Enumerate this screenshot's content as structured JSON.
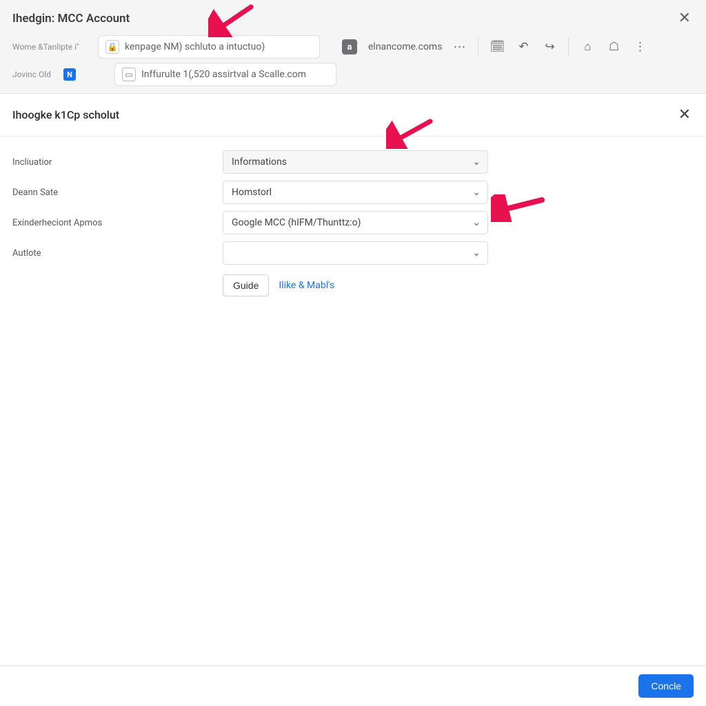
{
  "header": {
    "title": "Ihedgin: MCC Account",
    "breadcrumb1": "Wome &Tanlipte i\"",
    "breadcrumb2": "Jovinc Old",
    "url1": "kenpage NM) schluto a intuctuo)",
    "url2": "Inffurulte 1(,520 assirtval a Scalle.com",
    "domain": "elnancome.coms"
  },
  "section": {
    "title": "Ihoogke k1Cp scholut"
  },
  "form": {
    "row1": {
      "label": "Incliuatior",
      "value": "Informations"
    },
    "row2": {
      "label": "Deann Sate",
      "value": "Homstorl"
    },
    "row3": {
      "label": "Exinderheciont Apmos",
      "value": "Google MCC (hIFM/Thunttz:o)"
    },
    "row4": {
      "label": "Autlote",
      "value": ""
    }
  },
  "actions": {
    "guide": "Guide",
    "link": "Ilike & Mabl's"
  },
  "footer": {
    "primary": "Concle"
  }
}
